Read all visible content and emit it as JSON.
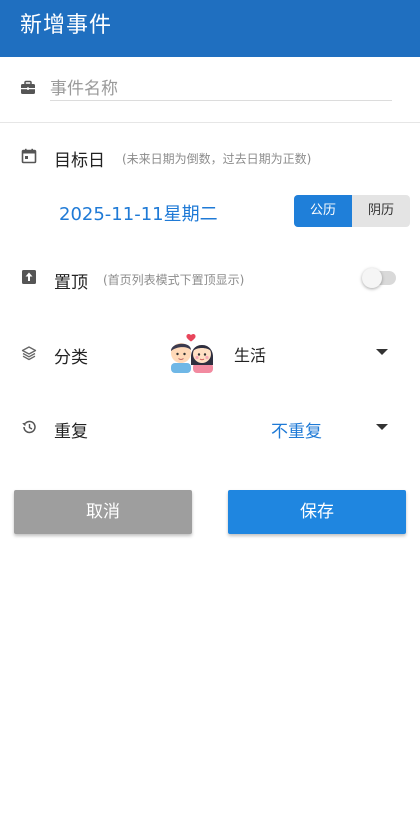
{
  "header": {
    "title": "新增事件"
  },
  "event_name": {
    "placeholder": "事件名称",
    "value": "",
    "icon": "briefcase-icon"
  },
  "target_date": {
    "label": "目标日",
    "hint": "(未来日期为倒数，过去日期为正数)",
    "value": "2025-11-11星期二",
    "calendar_options": [
      "公历",
      "阴历"
    ],
    "selected_calendar": "公历",
    "icon": "calendar-icon"
  },
  "pin_top": {
    "label": "置顶",
    "hint": "(首页列表模式下置顶显示)",
    "enabled": false,
    "icon": "pin-top-icon"
  },
  "category": {
    "label": "分类",
    "value": "生活",
    "icon": "layers-icon",
    "image": "couple-emoji-icon"
  },
  "repeat": {
    "label": "重复",
    "value": "不重复",
    "icon": "history-icon"
  },
  "actions": {
    "cancel": "取消",
    "save": "保存"
  },
  "colors": {
    "appbar": "#1f6fc0",
    "accent": "#1f7ad6",
    "save_button": "#1f86e0",
    "cancel_button": "#9e9e9e"
  }
}
